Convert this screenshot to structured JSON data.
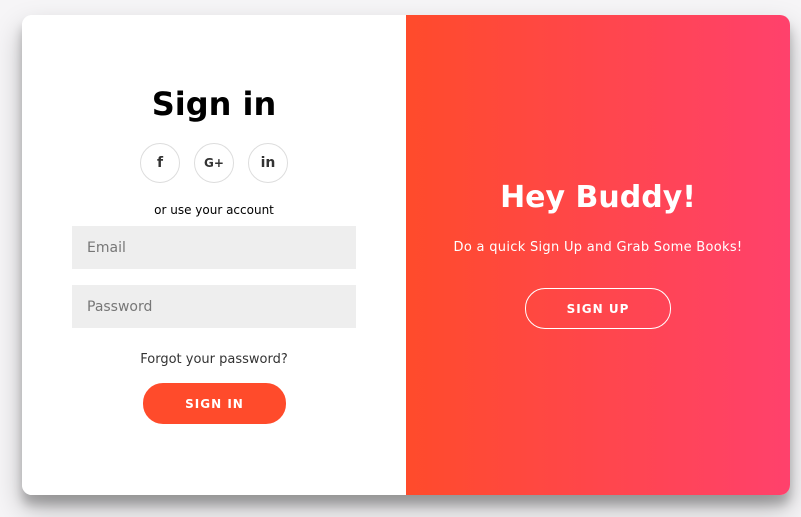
{
  "sign_in": {
    "title": "Sign in",
    "social": [
      {
        "icon": "facebook-icon",
        "glyph": "f"
      },
      {
        "icon": "google-plus-icon",
        "glyph": "G+"
      },
      {
        "icon": "linkedin-icon",
        "glyph": "in"
      }
    ],
    "or_text": "or use your account",
    "email_placeholder": "Email",
    "password_placeholder": "Password",
    "forgot_text": "Forgot your password?",
    "button_label": "SIGN IN"
  },
  "overlay": {
    "title": "Hey Buddy!",
    "tagline": "Do a quick Sign Up and Grab Some Books!",
    "button_label": "SIGN UP"
  },
  "colors": {
    "accent": "#ff4b2b",
    "gradient_end": "#ff416c",
    "input_bg": "#eeeeee"
  }
}
